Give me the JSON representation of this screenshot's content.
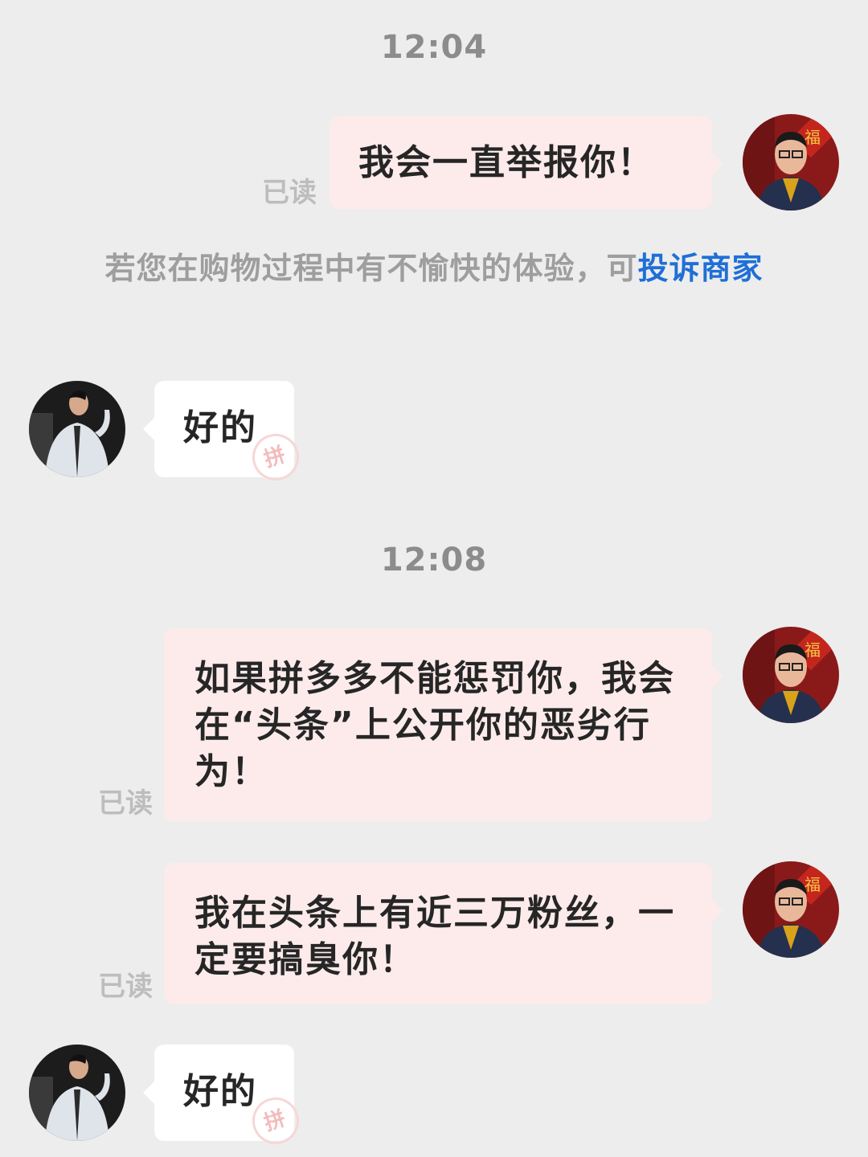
{
  "messages": {
    "time_1": "12:04",
    "msg_1": {
      "text": "我会一直举报你！",
      "read_label": "已读"
    },
    "notice": {
      "prefix": "若您在购物过程中有不愉快的体验，可",
      "link": "投诉商家"
    },
    "reply_1": {
      "text": "好的",
      "watermark": "拼"
    },
    "time_2": "12:08",
    "msg_2": {
      "text": "如果拼多多不能惩罚你，我会在“头条”上公开你的恶劣行为！",
      "read_label": "已读"
    },
    "msg_3": {
      "text": "我在头条上有近三万粉丝，一定要搞臭你！",
      "read_label": "已读"
    },
    "reply_2": {
      "text": "好的",
      "watermark": "拼"
    }
  },
  "colors": {
    "background": "#ededed",
    "outgoing_bubble": "#fdebeb",
    "incoming_bubble": "#ffffff",
    "link": "#1f6fd6"
  }
}
